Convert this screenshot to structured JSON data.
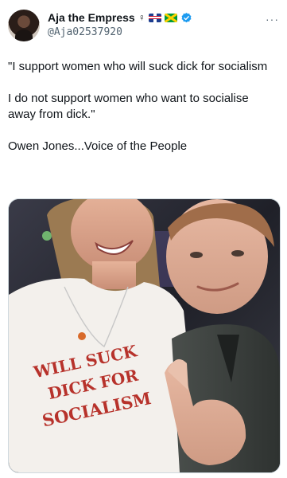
{
  "author": {
    "name": "Aja the Empress",
    "symbol": "♀",
    "handle": "@Aja02537920",
    "flags": [
      "uk-flag-icon",
      "jamaica-flag-icon"
    ],
    "verified_color": "#1d9bf0"
  },
  "more_label": "···",
  "tweet": {
    "text": "\"I support women who will suck dick for socialism\n\nI do not support women who want to socialise away from dick.\"\n\nOwen Jones...Voice of the People"
  },
  "media": {
    "shirt_lines": [
      "WILL SUCK",
      "DICK FOR",
      "SOCIALISM"
    ]
  }
}
